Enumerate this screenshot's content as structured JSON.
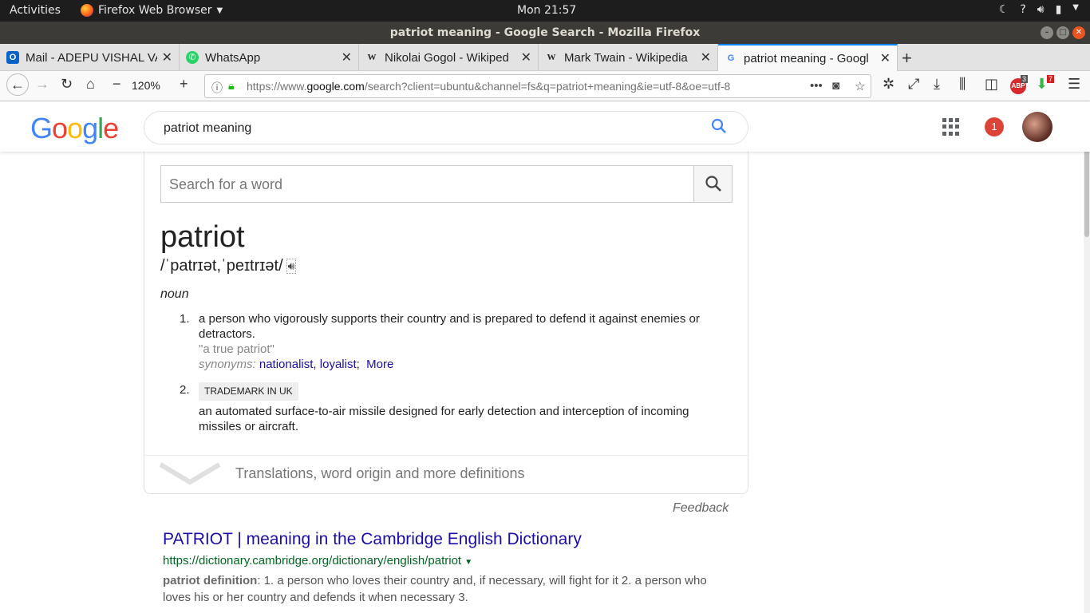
{
  "system": {
    "activities": "Activities",
    "app_name": "Firefox Web Browser",
    "clock": "Mon 21:57"
  },
  "window": {
    "title": "patriot meaning - Google Search - Mozilla Firefox"
  },
  "tabs": [
    {
      "label": "Mail - ADEPU VISHAL VA",
      "favicon": "outlook-icon"
    },
    {
      "label": "WhatsApp",
      "favicon": "whatsapp-icon"
    },
    {
      "label": "Nikolai Gogol - Wikiped",
      "favicon": "wikipedia-icon"
    },
    {
      "label": "Mark Twain - Wikipedia",
      "favicon": "wikipedia-icon"
    },
    {
      "label": "patriot meaning - Googl",
      "favicon": "google-icon"
    }
  ],
  "navbar": {
    "zoom": "120%",
    "url_prefix": "https://www.",
    "url_domain": "google.com",
    "url_rest": "/search?client=ubuntu&channel=fs&q=patriot+meaning&ie=utf-8&oe=utf-8",
    "abp_badge": "3",
    "download_badge": "7"
  },
  "google": {
    "query": "patriot meaning",
    "notifications": "1"
  },
  "dictionary": {
    "search_placeholder": "Search for a word",
    "word": "patriot",
    "phonetic": "/ˈpatrɪət,ˈpeɪtrɪət/",
    "part_of_speech": "noun",
    "def1": {
      "num": "1.",
      "text": "a person who vigorously supports their country and is prepared to defend it against enemies or detractors.",
      "example": "\"a true patriot\"",
      "syn_label": "synonyms:",
      "syn1": "nationalist",
      "syn2": "loyalist",
      "more": "More"
    },
    "def2": {
      "num": "2.",
      "tag": "TRADEMARK IN UK",
      "text": "an automated surface-to-air missile designed for early detection and interception of incoming missiles or aircraft."
    },
    "more_definitions": "Translations, word origin and more definitions"
  },
  "feedback": "Feedback",
  "result": {
    "title": "PATRIOT | meaning in the Cambridge English Dictionary",
    "url": "https://dictionary.cambridge.org/dictionary/english/patriot",
    "snippet_bold": "patriot definition",
    "snippet": ": 1. a person who loves their country and, if necessary, will fight for it 2. a person who loves his or her country and defends it when necessary 3."
  }
}
